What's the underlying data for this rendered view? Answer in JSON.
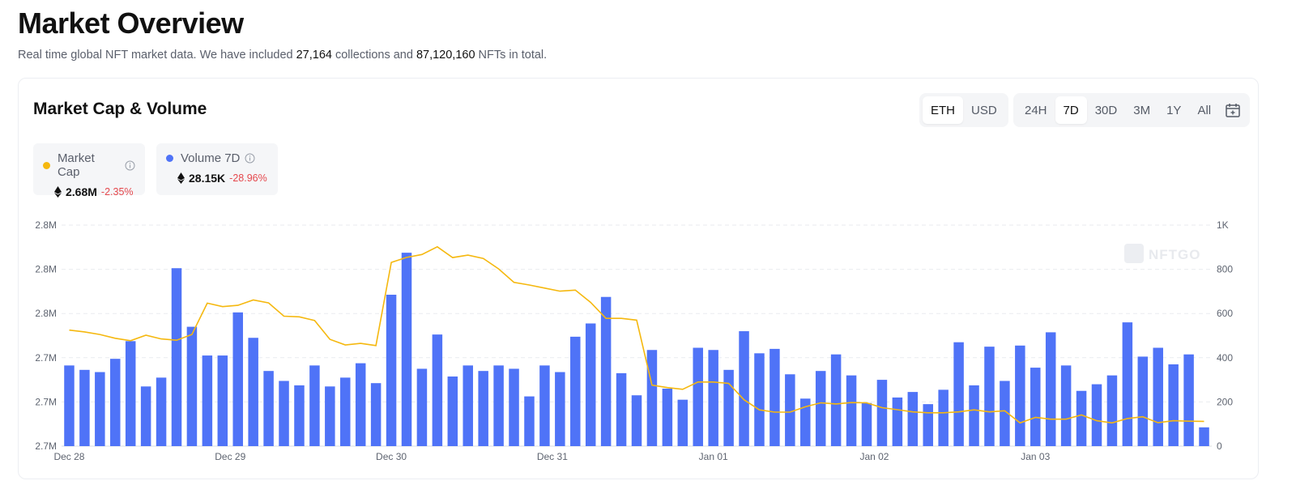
{
  "header": {
    "title": "Market Overview",
    "subtitle_prefix": "Real time global NFT market data. We have included ",
    "collections_count": "27,164",
    "subtitle_middle": " collections and ",
    "nfts_count": "87,120,160",
    "subtitle_suffix": " NFTs in total."
  },
  "card": {
    "title": "Market Cap & Volume",
    "currency_options": [
      {
        "label": "ETH",
        "active": true
      },
      {
        "label": "USD",
        "active": false
      }
    ],
    "range_options": [
      {
        "label": "24H",
        "active": false
      },
      {
        "label": "7D",
        "active": true
      },
      {
        "label": "30D",
        "active": false
      },
      {
        "label": "3M",
        "active": false
      },
      {
        "label": "1Y",
        "active": false
      },
      {
        "label": "All",
        "active": false
      }
    ],
    "calendar_icon": "calendar-icon",
    "legend": [
      {
        "name": "Market Cap",
        "value": "2.68M",
        "change": "-2.35%",
        "color": "#f5b80f",
        "icon": "eth-icon"
      },
      {
        "name": "Volume 7D",
        "value": "28.15K",
        "change": "-28.96%",
        "color": "#4f73f7",
        "icon": "eth-icon"
      }
    ]
  },
  "chart_data": {
    "type": "bar",
    "watermark": "NFTGO",
    "x_tick_labels": [
      "Dec 28",
      "Dec 29",
      "Dec 30",
      "Dec 31",
      "Jan 01",
      "Jan 02",
      "Jan 03"
    ],
    "y_left_tick_labels": [
      "2.7M",
      "2.7M",
      "2.7M",
      "2.8M",
      "2.8M",
      "2.8M"
    ],
    "y_right_tick_labels": [
      "0",
      "200",
      "400",
      "600",
      "800",
      "1K"
    ],
    "y_right_range": [
      0,
      1000
    ],
    "grid": true,
    "series": [
      {
        "name": "Volume 7D",
        "type": "bar",
        "axis": "right",
        "color": "#4f73f7",
        "values": [
          365,
          345,
          335,
          395,
          475,
          270,
          310,
          805,
          540,
          410,
          410,
          605,
          490,
          340,
          295,
          275,
          365,
          270,
          310,
          375,
          285,
          685,
          875,
          350,
          505,
          315,
          365,
          340,
          365,
          350,
          225,
          365,
          335,
          495,
          555,
          675,
          330,
          230,
          435,
          260,
          210,
          445,
          435,
          345,
          520,
          420,
          440,
          325,
          215,
          340,
          415,
          320,
          195,
          300,
          220,
          245,
          190,
          255,
          470,
          275,
          450,
          295,
          455,
          355,
          515,
          365,
          250,
          280,
          320,
          560,
          405,
          445,
          370,
          415,
          85
        ]
      },
      {
        "name": "Market Cap",
        "type": "line",
        "axis": "left",
        "color": "#f5b80f",
        "values": [
          0.525,
          0.517,
          0.505,
          0.488,
          0.477,
          0.502,
          0.485,
          0.479,
          0.505,
          0.647,
          0.631,
          0.637,
          0.661,
          0.648,
          0.588,
          0.585,
          0.568,
          0.483,
          0.458,
          0.465,
          0.455,
          0.831,
          0.854,
          0.867,
          0.902,
          0.853,
          0.864,
          0.849,
          0.802,
          0.741,
          0.729,
          0.715,
          0.701,
          0.706,
          0.65,
          0.578,
          0.578,
          0.57,
          0.276,
          0.265,
          0.257,
          0.29,
          0.29,
          0.284,
          0.21,
          0.164,
          0.154,
          0.154,
          0.178,
          0.196,
          0.191,
          0.197,
          0.196,
          0.174,
          0.165,
          0.155,
          0.151,
          0.151,
          0.155,
          0.164,
          0.155,
          0.16,
          0.105,
          0.13,
          0.122,
          0.122,
          0.141,
          0.115,
          0.105,
          0.125,
          0.133,
          0.106,
          0.115,
          0.113,
          0.112
        ]
      }
    ]
  }
}
